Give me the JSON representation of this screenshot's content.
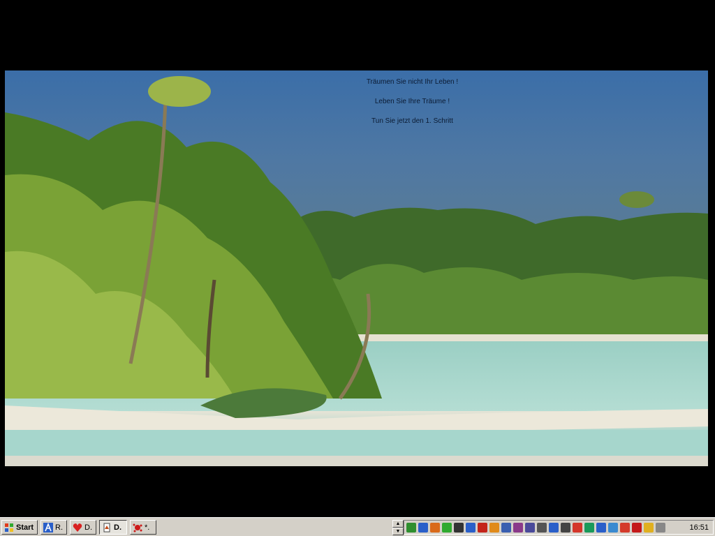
{
  "screen": {
    "captions": [
      "Träumen Sie nicht Ihr Leben !",
      "Leben Sie Ihre Träume !",
      "Tun Sie jetzt den 1. Schritt"
    ]
  },
  "taskbar": {
    "start_label": "Start",
    "buttons": [
      {
        "label": "R.",
        "icon": "app-a-icon",
        "color": "#2a5fc9"
      },
      {
        "label": "D.",
        "icon": "heart-icon",
        "color": "#d92020"
      },
      {
        "label": "D.",
        "icon": "document-icon",
        "color": "#c44a1a"
      },
      {
        "label": "*.",
        "icon": "paint-splash-icon",
        "color": "#cc1a1a"
      }
    ],
    "clock": "16:51",
    "tray_icon_colors": [
      "#2f8f2f",
      "#2a5fc9",
      "#d96a1a",
      "#2faa2f",
      "#333333",
      "#2a5fc9",
      "#c4241a",
      "#e08a1a",
      "#3a5fb0",
      "#8a3a8a",
      "#4a4a9a",
      "#555555",
      "#2a5fc9",
      "#444444",
      "#d4362a",
      "#1a9a5a",
      "#2a5fc9",
      "#3a8ad0",
      "#d43a2a",
      "#c41a1a",
      "#e0b020",
      "#888888"
    ]
  }
}
